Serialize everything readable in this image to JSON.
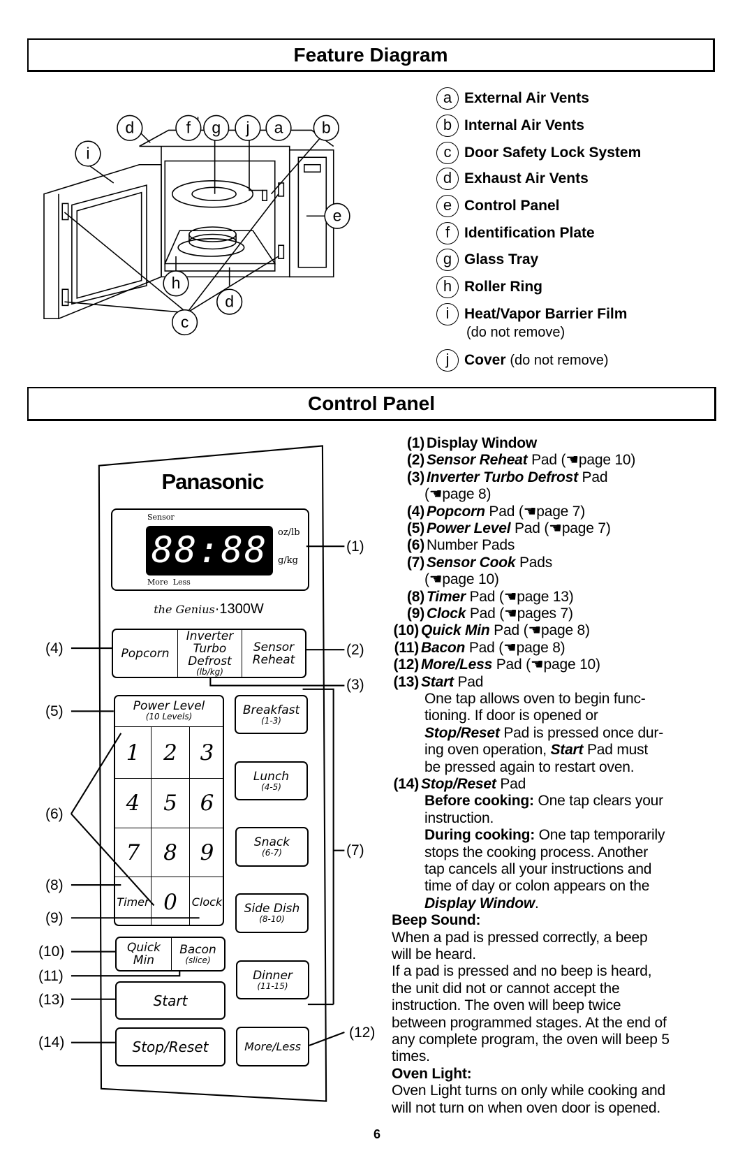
{
  "feature_diagram": {
    "title": "Feature Diagram",
    "callouts": [
      "d",
      "f",
      "g",
      "j",
      "a",
      "b",
      "i",
      "e",
      "h",
      "d",
      "c"
    ],
    "legend": [
      {
        "letter": "a",
        "label": "External Air Vents"
      },
      {
        "letter": "b",
        "label": "Internal Air Vents"
      },
      {
        "letter": "c",
        "label": "Door Safety Lock System"
      },
      {
        "letter": "d",
        "label": "Exhaust Air Vents"
      },
      {
        "letter": "e",
        "label": "Control Panel"
      },
      {
        "letter": "f",
        "label": "Identification Plate"
      },
      {
        "letter": "g",
        "label": "Glass Tray"
      },
      {
        "letter": "h",
        "label": "Roller Ring"
      },
      {
        "letter": "i",
        "label": "Heat/Vapor Barrier Film",
        "note": "(do not remove)"
      },
      {
        "letter": "j",
        "label": "Cover",
        "note": "(do not remove)"
      }
    ]
  },
  "control_panel": {
    "title": "Control Panel",
    "brand": "Panasonic",
    "display": {
      "digits": "88:88",
      "sensor": "Sensor",
      "more_less": "More  Less",
      "unit1": "oz/lb",
      "unit2": "g/kg"
    },
    "model": {
      "script": "the Genius",
      "power": "·1300W"
    },
    "top_pads": [
      {
        "label": "Popcorn"
      },
      {
        "label": "Inverter Turbo Defrost",
        "sub": "(lb/kg)"
      },
      {
        "label": "Sensor Reheat"
      }
    ],
    "power_level": {
      "label": "Power Level",
      "sub": "(10 Levels)"
    },
    "number_pads": [
      "1",
      "2",
      "3",
      "4",
      "5",
      "6",
      "7",
      "8",
      "9",
      "Timer",
      "0",
      "Clock"
    ],
    "quick_min": "Quick Min",
    "bacon": {
      "label": "Bacon",
      "sub": "(slice)"
    },
    "start": "Start",
    "stop_reset": "Stop/Reset",
    "sensor_pads": [
      {
        "label": "Breakfast",
        "sub": "(1-3)"
      },
      {
        "label": "Lunch",
        "sub": "(4-5)"
      },
      {
        "label": "Snack",
        "sub": "(6-7)"
      },
      {
        "label": "Side Dish",
        "sub": "(8-10)"
      },
      {
        "label": "Dinner",
        "sub": "(11-15)"
      }
    ],
    "more_less": "More/Less",
    "callouts": {
      "c1": "(1)",
      "c2": "(2)",
      "c3": "(3)",
      "c4": "(4)",
      "c5": "(5)",
      "c6": "(6)",
      "c7": "(7)",
      "c8": "(8)",
      "c9": "(9)",
      "c10": "(10)",
      "c11": "(11)",
      "c12": "(12)",
      "c13": "(13)",
      "c14": "(14)"
    }
  },
  "description": {
    "items": [
      {
        "n": "(1)",
        "b": "Display Window"
      },
      {
        "n": "(2)",
        "bi": "Sensor Reheat",
        "t": " Pad (☚page 10)"
      },
      {
        "n": "(3)",
        "bi": "Inverter Turbo Defrost",
        "t": " Pad"
      },
      {
        "cont": "(☚page 8)"
      },
      {
        "n": "(4)",
        "bi": "Popcorn",
        "t": " Pad (☚page 7)"
      },
      {
        "n": "(5)",
        "bi": "Power Level",
        "t": " Pad (☚page 7)"
      },
      {
        "n": "(6)",
        "t": "Number Pads"
      },
      {
        "n": "(7)",
        "bi": "Sensor Cook",
        "t": " Pads"
      },
      {
        "cont": "(☚page 10)"
      },
      {
        "n": "(8)",
        "bi": "Timer",
        "t": " Pad (☚page 13)"
      },
      {
        "n": "(9)",
        "bi": "Clock",
        "t": " Pad (☚pages 7)"
      },
      {
        "n": "(10)",
        "bi": "Quick Min",
        "t": " Pad (☚page 8)"
      },
      {
        "n": "(11)",
        "bi": "Bacon",
        "t": " Pad (☚page 8)"
      },
      {
        "n": "(12)",
        "bi": "More/Less",
        "t": " Pad (☚page 10)"
      },
      {
        "n": "(13)",
        "bi": "Start",
        "t": " Pad"
      }
    ],
    "start_text": [
      "One tap allows oven to begin func-",
      "tioning. If door is opened or"
    ],
    "start_l3": {
      "bi": "Stop/Reset",
      "t": " Pad is pressed once dur-"
    },
    "start_l4": {
      "t": "ing oven operation, ",
      "bi": "Start",
      "t2": " Pad must"
    },
    "start_l5": "be pressed again to restart oven.",
    "stop": {
      "n": "(14)",
      "bi": "Stop/Reset",
      "t": " Pad"
    },
    "before": {
      "b": "Before cooking:",
      "t": " One tap clears your",
      "t2": "instruction."
    },
    "during": {
      "b": "During cooking:",
      "t": " One tap temporarily",
      "lines": [
        "stops the cooking process.  Another",
        "tap cancels all your instructions and",
        "time of day or colon appears on the"
      ],
      "bi": "Display Window",
      "end": "."
    },
    "beep_title": "Beep Sound:",
    "beep_lines": [
      "When a pad is pressed correctly, a beep",
      "will be heard.",
      "If a pad is pressed and no beep is heard,",
      "the unit did not or cannot accept the",
      "instruction. The oven will beep twice",
      "between programmed stages. At the end of",
      "any complete program, the oven will beep 5",
      "times."
    ],
    "light_title": "Oven Light:",
    "light_lines": [
      "Oven Light turns on only while cooking and",
      "will not turn on when oven door is opened."
    ]
  },
  "page_number": "6"
}
